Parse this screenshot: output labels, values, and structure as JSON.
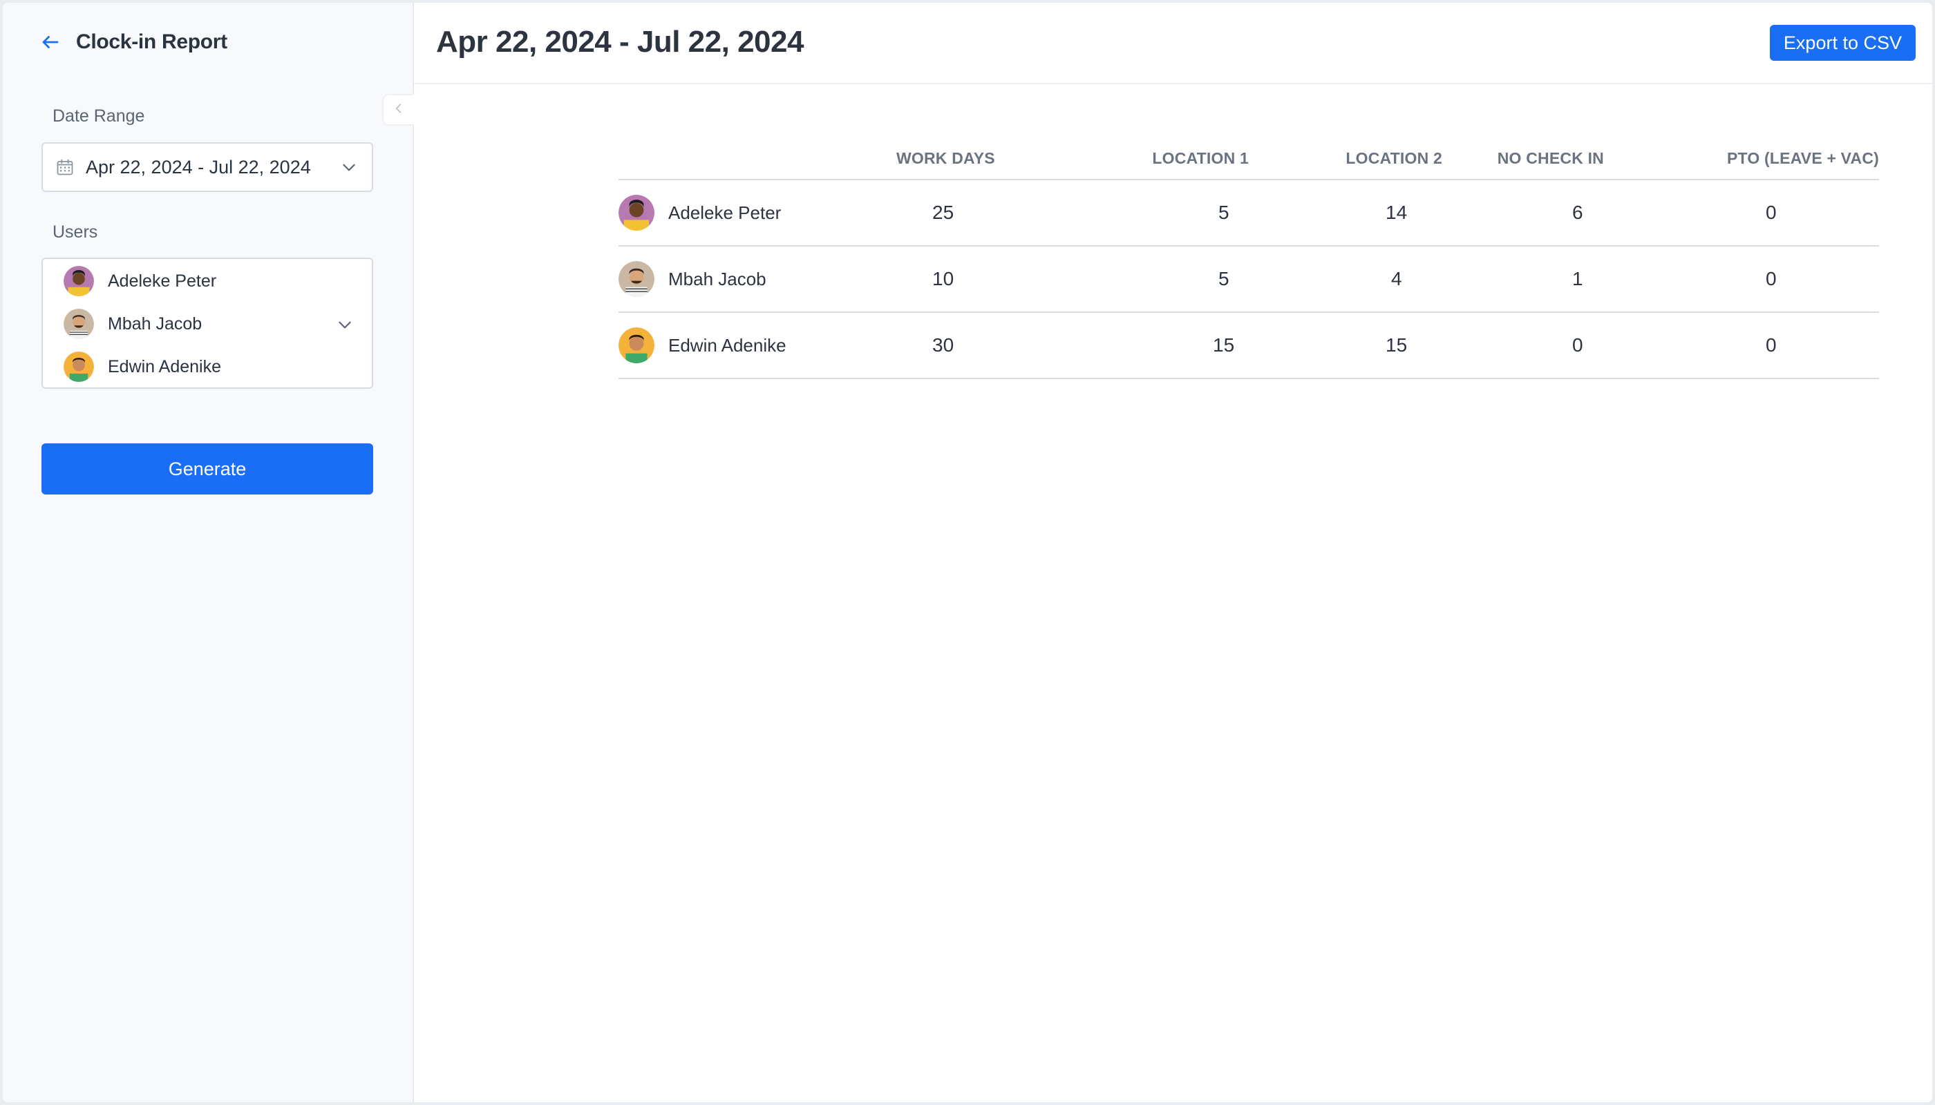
{
  "sidebar": {
    "title": "Clock-in Report",
    "date_range_label": "Date Range",
    "date_range_value": "Apr 22, 2024 - Jul 22, 2024",
    "users_label": "Users",
    "selected_users": [
      {
        "name": "Adeleke Peter"
      },
      {
        "name": "Mbah Jacob"
      },
      {
        "name": "Edwin Adenike"
      }
    ],
    "generate_label": "Generate"
  },
  "main": {
    "title": "Apr 22, 2024 - Jul 22, 2024",
    "export_label": "Export to CSV"
  },
  "table": {
    "columns": [
      "",
      "WORK DAYS",
      "LOCATION 1",
      "LOCATION 2",
      "NO CHECK IN",
      "PTO (LEAVE + VAC)"
    ],
    "rows": [
      {
        "name": "Adeleke Peter",
        "work_days": "25",
        "location_1": "5",
        "location_2": "14",
        "no_check_in": "6",
        "pto": "0"
      },
      {
        "name": "Mbah Jacob",
        "work_days": "10",
        "location_1": "5",
        "location_2": "4",
        "no_check_in": "1",
        "pto": "0"
      },
      {
        "name": "Edwin Adenike",
        "work_days": "30",
        "location_1": "15",
        "location_2": "15",
        "no_check_in": "0",
        "pto": "0"
      }
    ]
  },
  "colors": {
    "accent": "#1a6ef5",
    "sidebar_bg": "#f7f9fc",
    "text": "#2d3440"
  },
  "icons": {
    "back": "arrow-left-icon",
    "collapse": "chevron-left-icon",
    "calendar": "calendar-icon",
    "dropdown": "chevron-down-icon"
  }
}
